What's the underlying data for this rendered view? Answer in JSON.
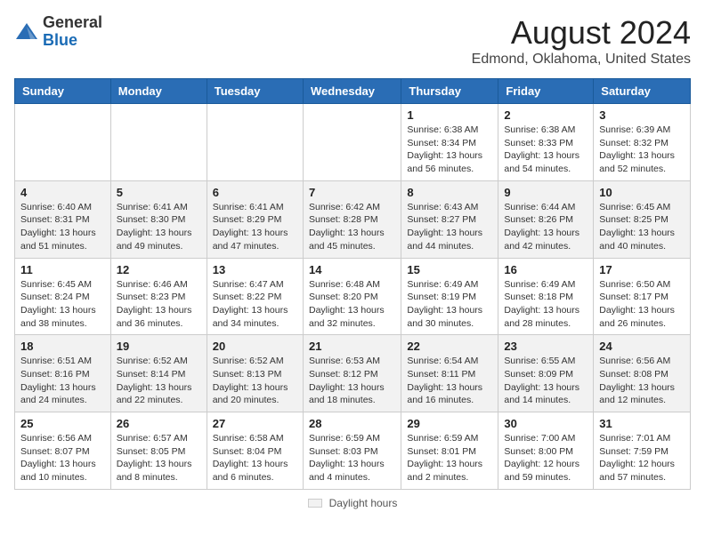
{
  "header": {
    "logo_general": "General",
    "logo_blue": "Blue",
    "month_title": "August 2024",
    "location": "Edmond, Oklahoma, United States"
  },
  "days_of_week": [
    "Sunday",
    "Monday",
    "Tuesday",
    "Wednesday",
    "Thursday",
    "Friday",
    "Saturday"
  ],
  "weeks": [
    [
      {
        "day": "",
        "info": ""
      },
      {
        "day": "",
        "info": ""
      },
      {
        "day": "",
        "info": ""
      },
      {
        "day": "",
        "info": ""
      },
      {
        "day": "1",
        "info": "Sunrise: 6:38 AM\nSunset: 8:34 PM\nDaylight: 13 hours and 56 minutes."
      },
      {
        "day": "2",
        "info": "Sunrise: 6:38 AM\nSunset: 8:33 PM\nDaylight: 13 hours and 54 minutes."
      },
      {
        "day": "3",
        "info": "Sunrise: 6:39 AM\nSunset: 8:32 PM\nDaylight: 13 hours and 52 minutes."
      }
    ],
    [
      {
        "day": "4",
        "info": "Sunrise: 6:40 AM\nSunset: 8:31 PM\nDaylight: 13 hours and 51 minutes."
      },
      {
        "day": "5",
        "info": "Sunrise: 6:41 AM\nSunset: 8:30 PM\nDaylight: 13 hours and 49 minutes."
      },
      {
        "day": "6",
        "info": "Sunrise: 6:41 AM\nSunset: 8:29 PM\nDaylight: 13 hours and 47 minutes."
      },
      {
        "day": "7",
        "info": "Sunrise: 6:42 AM\nSunset: 8:28 PM\nDaylight: 13 hours and 45 minutes."
      },
      {
        "day": "8",
        "info": "Sunrise: 6:43 AM\nSunset: 8:27 PM\nDaylight: 13 hours and 44 minutes."
      },
      {
        "day": "9",
        "info": "Sunrise: 6:44 AM\nSunset: 8:26 PM\nDaylight: 13 hours and 42 minutes."
      },
      {
        "day": "10",
        "info": "Sunrise: 6:45 AM\nSunset: 8:25 PM\nDaylight: 13 hours and 40 minutes."
      }
    ],
    [
      {
        "day": "11",
        "info": "Sunrise: 6:45 AM\nSunset: 8:24 PM\nDaylight: 13 hours and 38 minutes."
      },
      {
        "day": "12",
        "info": "Sunrise: 6:46 AM\nSunset: 8:23 PM\nDaylight: 13 hours and 36 minutes."
      },
      {
        "day": "13",
        "info": "Sunrise: 6:47 AM\nSunset: 8:22 PM\nDaylight: 13 hours and 34 minutes."
      },
      {
        "day": "14",
        "info": "Sunrise: 6:48 AM\nSunset: 8:20 PM\nDaylight: 13 hours and 32 minutes."
      },
      {
        "day": "15",
        "info": "Sunrise: 6:49 AM\nSunset: 8:19 PM\nDaylight: 13 hours and 30 minutes."
      },
      {
        "day": "16",
        "info": "Sunrise: 6:49 AM\nSunset: 8:18 PM\nDaylight: 13 hours and 28 minutes."
      },
      {
        "day": "17",
        "info": "Sunrise: 6:50 AM\nSunset: 8:17 PM\nDaylight: 13 hours and 26 minutes."
      }
    ],
    [
      {
        "day": "18",
        "info": "Sunrise: 6:51 AM\nSunset: 8:16 PM\nDaylight: 13 hours and 24 minutes."
      },
      {
        "day": "19",
        "info": "Sunrise: 6:52 AM\nSunset: 8:14 PM\nDaylight: 13 hours and 22 minutes."
      },
      {
        "day": "20",
        "info": "Sunrise: 6:52 AM\nSunset: 8:13 PM\nDaylight: 13 hours and 20 minutes."
      },
      {
        "day": "21",
        "info": "Sunrise: 6:53 AM\nSunset: 8:12 PM\nDaylight: 13 hours and 18 minutes."
      },
      {
        "day": "22",
        "info": "Sunrise: 6:54 AM\nSunset: 8:11 PM\nDaylight: 13 hours and 16 minutes."
      },
      {
        "day": "23",
        "info": "Sunrise: 6:55 AM\nSunset: 8:09 PM\nDaylight: 13 hours and 14 minutes."
      },
      {
        "day": "24",
        "info": "Sunrise: 6:56 AM\nSunset: 8:08 PM\nDaylight: 13 hours and 12 minutes."
      }
    ],
    [
      {
        "day": "25",
        "info": "Sunrise: 6:56 AM\nSunset: 8:07 PM\nDaylight: 13 hours and 10 minutes."
      },
      {
        "day": "26",
        "info": "Sunrise: 6:57 AM\nSunset: 8:05 PM\nDaylight: 13 hours and 8 minutes."
      },
      {
        "day": "27",
        "info": "Sunrise: 6:58 AM\nSunset: 8:04 PM\nDaylight: 13 hours and 6 minutes."
      },
      {
        "day": "28",
        "info": "Sunrise: 6:59 AM\nSunset: 8:03 PM\nDaylight: 13 hours and 4 minutes."
      },
      {
        "day": "29",
        "info": "Sunrise: 6:59 AM\nSunset: 8:01 PM\nDaylight: 13 hours and 2 minutes."
      },
      {
        "day": "30",
        "info": "Sunrise: 7:00 AM\nSunset: 8:00 PM\nDaylight: 12 hours and 59 minutes."
      },
      {
        "day": "31",
        "info": "Sunrise: 7:01 AM\nSunset: 7:59 PM\nDaylight: 12 hours and 57 minutes."
      }
    ]
  ],
  "footer": {
    "legend_label": "Daylight hours"
  }
}
